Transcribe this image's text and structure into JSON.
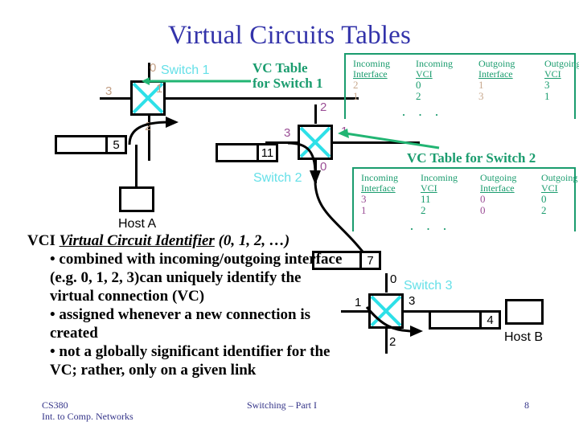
{
  "slide": {
    "title": "Virtual Circuits Tables",
    "colors": {
      "title": "#3333aa",
      "green": "#1a9c6e",
      "cyan": "#66e0e8",
      "tan": "#c8a98e",
      "purple": "#9b4f96",
      "footer": "#333388"
    }
  },
  "diagram": {
    "switch1": {
      "name": "Switch 1",
      "ports": {
        "top": "0",
        "left": "3",
        "right": "1",
        "bottom": "2"
      }
    },
    "switch2": {
      "name": "Switch 2",
      "ports": {
        "top": "2",
        "left": "3",
        "right": "1",
        "bottom": "0"
      }
    },
    "switch3": {
      "name": "Switch 3",
      "ports": {
        "top": "0",
        "left": "1",
        "right": "3",
        "bottom": "2"
      }
    },
    "packets": [
      {
        "label": "5"
      },
      {
        "label": "11"
      },
      {
        "label": "7"
      },
      {
        "label": "4"
      }
    ],
    "hosts": [
      {
        "label": "Host A"
      },
      {
        "label": "Host B"
      }
    ]
  },
  "tables": {
    "headers": [
      "Incoming Interface",
      "Incoming VCI",
      "Outgoing Interface",
      "Outgoing VCI"
    ],
    "header_parts": [
      {
        "line1": "Incoming",
        "line2": "Interface"
      },
      {
        "line1": "Incoming",
        "line2": "VCI"
      },
      {
        "line1": "Outgoing",
        "line2": "Interface"
      },
      {
        "line1": "Outgoing",
        "line2": "VCI"
      }
    ],
    "dots": "· · ·",
    "switch1": {
      "caption_line1": "VC Table",
      "caption_line2": "for Switch 1",
      "rows": [
        {
          "in_if": "2",
          "in_vci": "0",
          "out_if": "1",
          "out_vci": "3"
        },
        {
          "in_if": "1",
          "in_vci": "2",
          "out_if": "3",
          "out_vci": "1"
        }
      ]
    },
    "switch2": {
      "caption": "VC Table for Switch 2",
      "rows": [
        {
          "in_if": "3",
          "in_vci": "11",
          "out_if": "0",
          "out_vci": "0"
        },
        {
          "in_if": "1",
          "in_vci": "2",
          "out_if": "0",
          "out_vci": "2"
        }
      ]
    }
  },
  "body": {
    "term": "VCI",
    "expansion": "Virtual Circuit Identifier",
    "examples": " (0, 1, 2, …)",
    "bullets": [
      "• combined with incoming/outgoing interface (e.g. 0, 1, 2, 3)can uniquely identify the virtual connection (VC)",
      "• assigned whenever a new connection is created",
      "• not a globally significant identifier for the VC; rather, only on a given link"
    ]
  },
  "footer": {
    "left": "CS380\nInt. to Comp. Networks",
    "center": "Switching – Part I",
    "right": "8"
  }
}
